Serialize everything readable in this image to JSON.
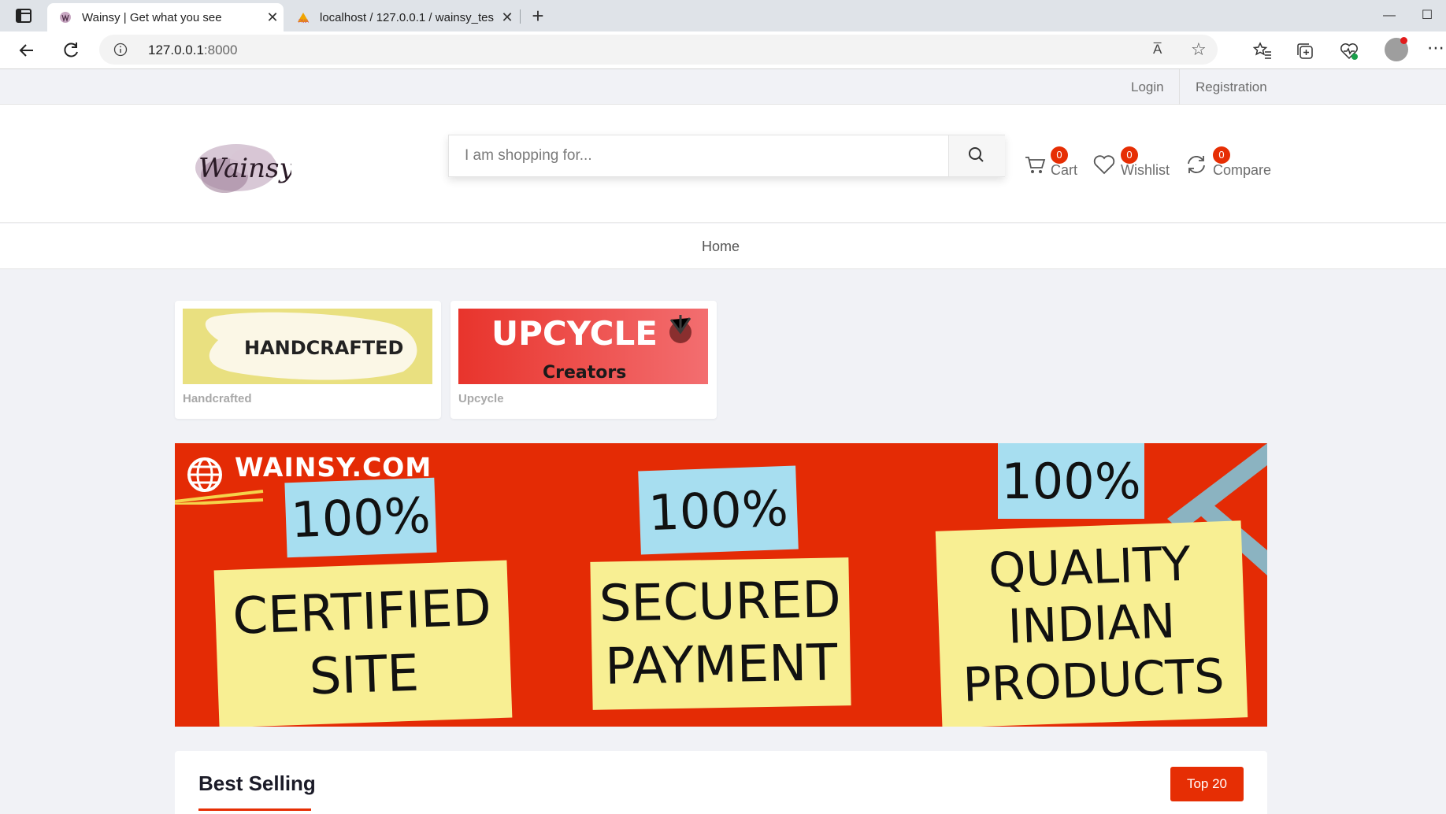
{
  "browser": {
    "tabs": [
      {
        "title": "Wainsy | Get what you see"
      },
      {
        "title": "localhost / 127.0.0.1 / wainsy_tes"
      }
    ],
    "address": {
      "host": "127.0.0.1",
      "port": ":8000"
    },
    "readaloud": "A̅",
    "window_controls": [
      "—",
      "☐"
    ]
  },
  "topbar": {
    "login": "Login",
    "registration": "Registration"
  },
  "header": {
    "logo_text": "Wainsy",
    "search_placeholder": "I am shopping for...",
    "cart": {
      "label": "Cart",
      "count": "0"
    },
    "wishlist": {
      "label": "Wishlist",
      "count": "0"
    },
    "compare": {
      "label": "Compare",
      "count": "0"
    }
  },
  "menu": {
    "home": "Home"
  },
  "categories": [
    {
      "image_text": "HANDCRAFTED",
      "caption": "Handcrafted",
      "color": "#e9e080"
    },
    {
      "image_text_1": "UPCYCLE",
      "image_text_2": "Creators",
      "caption": "Upcycle",
      "color": "#ef4d3f"
    }
  ],
  "banner": {
    "site": "WAINSY.COM",
    "col1": {
      "top": "100%",
      "line1": "CERTIFIED",
      "line2": "SITE"
    },
    "col2": {
      "top": "100%",
      "line1": "SECURED",
      "line2": "PAYMENT"
    },
    "col3": {
      "top": "100%",
      "line1": "QUALITY",
      "line2": "INDIAN",
      "line3": "PRODUCTS"
    },
    "bg_color": "#e42b05"
  },
  "best_selling": {
    "title": "Best Selling",
    "button": "Top 20"
  },
  "accent_color": "#e62e04"
}
